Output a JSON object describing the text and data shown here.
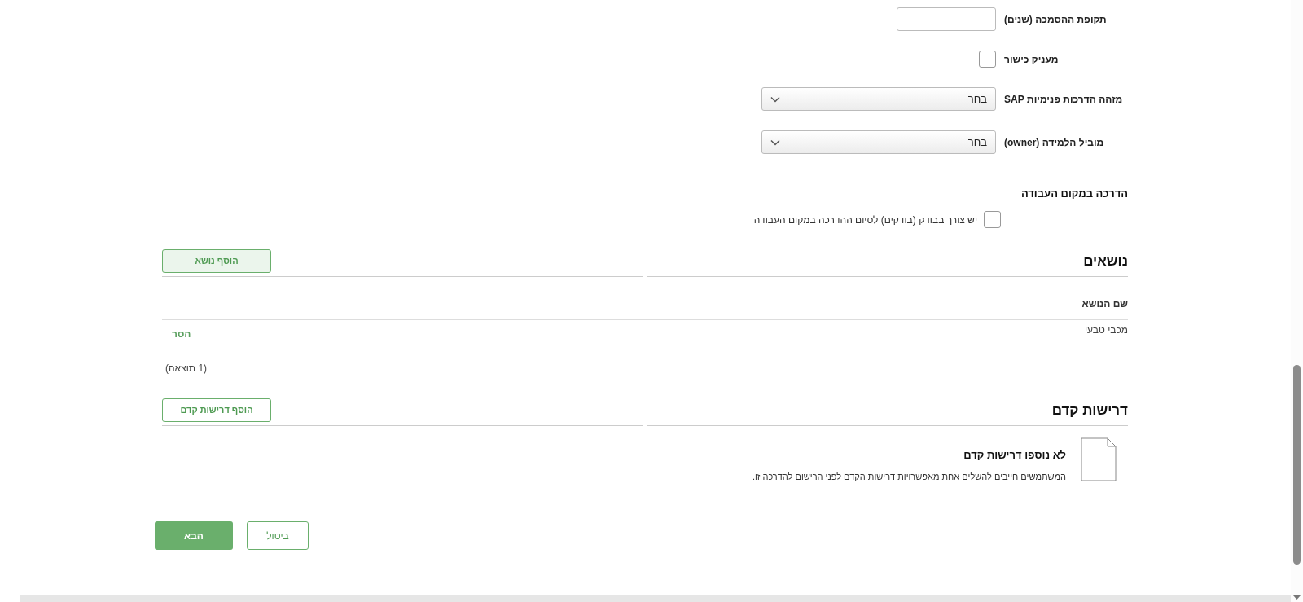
{
  "form_fields": [
    {
      "kind": "text",
      "label": "תקופת ההסמכה (שנים)"
    },
    {
      "kind": "checkbox",
      "label": "מעניק כישור",
      "checked": false
    },
    {
      "kind": "select",
      "label": "מזהה הדרכות פנימיות SAP",
      "value": "בחר"
    },
    {
      "kind": "select",
      "label": "מוביל הלמידה (owner)",
      "value": "בחר"
    }
  ],
  "workplace_training": {
    "heading": "הדרכה במקום העבודה",
    "checkbox": {
      "label": "יש צורך בבודק (בודקים) לסיום ההדרכה במקום העבודה",
      "checked": false
    }
  },
  "topics": {
    "heading": "נושאים",
    "add_button": {
      "label": "הוסף נושא",
      "highlighted": true
    },
    "columns": [
      "שם הנושא"
    ],
    "rows": [
      {
        "name": "מכבי טבעי",
        "remove_link": "הסר"
      }
    ],
    "result_count": "(1 תוצאה)"
  },
  "prerequisites": {
    "heading": "דרישות קדם",
    "add_button": {
      "label": "הוסף דרישות קדם",
      "highlighted": false
    },
    "empty_title": "לא נוספו דרישות קדם",
    "empty_text": "המשתמשים חייבים להשלים אחת מאפשרויות דרישות הקדם לפני הרישום להדרכה זו."
  },
  "footer_buttons": [
    {
      "label": "ביטול",
      "kind": "secondary"
    },
    {
      "label": "הבא",
      "kind": "primary"
    }
  ]
}
